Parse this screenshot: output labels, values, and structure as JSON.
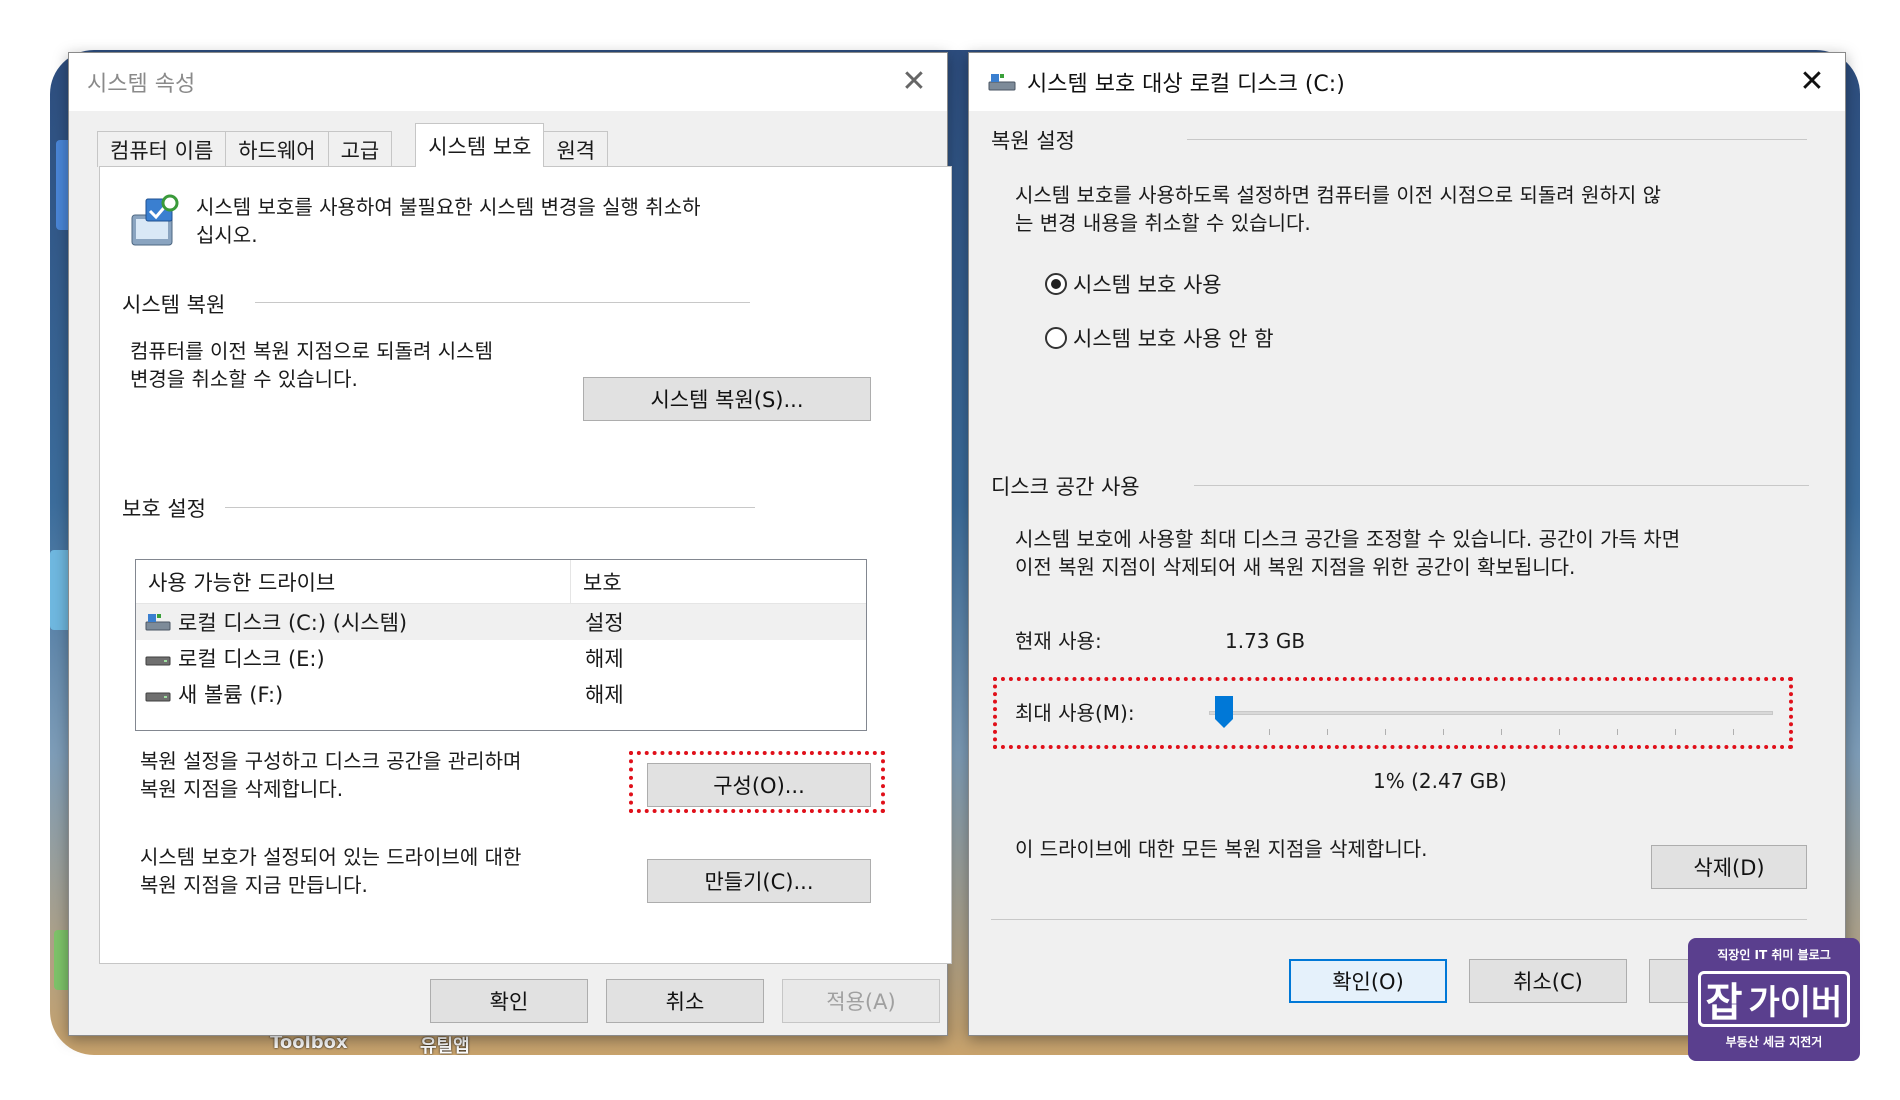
{
  "desktop": {
    "labels": [
      "Toolbox",
      "유틸앱"
    ]
  },
  "left_window": {
    "title": "시스템 속성",
    "tabs": [
      {
        "label": "컴퓨터 이름"
      },
      {
        "label": "하드웨어"
      },
      {
        "label": "고급"
      },
      {
        "label": "시스템 보호"
      },
      {
        "label": "원격"
      }
    ],
    "intro_text": "시스템 보호를 사용하여 불필요한 시스템 변경을 실행 취소하십시오.",
    "intro_text_line1": "시스템 보호를 사용하여 불필요한 시스템 변경을 실행 취소하",
    "intro_text_line2": "십시오.",
    "restore_section": {
      "heading": "시스템 복원",
      "desc_line1": "컴퓨터를 이전 복원 지점으로 되돌려 시스템",
      "desc_line2": "변경을 취소할 수 있습니다.",
      "button": "시스템 복원(S)..."
    },
    "protection_section": {
      "heading": "보호 설정",
      "columns": [
        "사용 가능한 드라이브",
        "보호"
      ],
      "rows": [
        {
          "drive": "로컬 디스크 (C:) (시스템)",
          "status": "설정",
          "icon": "system-drive-icon",
          "selected": true
        },
        {
          "drive": "로컬 디스크 (E:)",
          "status": "해제",
          "icon": "drive-icon",
          "selected": false
        },
        {
          "drive": "새 볼륨 (F:)",
          "status": "해제",
          "icon": "drive-icon",
          "selected": false
        }
      ],
      "configure_desc_line1": "복원 설정을 구성하고 디스크 공간을 관리하며",
      "configure_desc_line2": "복원 지점을 삭제합니다.",
      "configure_button": "구성(O)...",
      "create_desc_line1": "시스템 보호가 설정되어 있는 드라이브에 대한",
      "create_desc_line2": "복원 지점을 지금 만듭니다.",
      "create_button": "만들기(C)..."
    },
    "footer": {
      "ok": "확인",
      "cancel": "취소",
      "apply": "적용(A)"
    }
  },
  "right_window": {
    "title": "시스템 보호 대상 로컬 디스크 (C:)",
    "restore_settings": {
      "heading": "복원 설정",
      "desc_line1": "시스템 보호를 사용하도록 설정하면 컴퓨터를 이전 시점으로 되돌려 원하지 않",
      "desc_line2": "는 변경 내용을 취소할 수 있습니다.",
      "options": [
        {
          "label": "시스템 보호 사용",
          "selected": true
        },
        {
          "label": "시스템 보호 사용 안 함",
          "selected": false
        }
      ]
    },
    "disk_usage": {
      "heading": "디스크 공간 사용",
      "desc_line1": "시스템 보호에 사용할 최대 디스크 공간을 조정할 수 있습니다. 공간이 가득 차면",
      "desc_line2": "이전 복원 지점이 삭제되어 새 복원 지점을 위한 공간이 확보됩니다.",
      "current_label": "현재 사용:",
      "current_value": "1.73 GB",
      "max_label": "최대 사용(M):",
      "max_percent": 1,
      "max_value_text": "1% (2.47 GB)",
      "delete_desc": "이 드라이브에 대한 모든 복원 지점을 삭제합니다.",
      "delete_button": "삭제(D)"
    },
    "footer": {
      "ok": "확인(O)",
      "cancel": "취소(C)"
    }
  },
  "badge": {
    "top": "직장인 IT 취미 블로그",
    "main_big": "잡",
    "main": "가이버",
    "bottom": "부동산 세금 지전거"
  },
  "colors": {
    "highlight": "#e0101a",
    "accent": "#0078d7"
  }
}
